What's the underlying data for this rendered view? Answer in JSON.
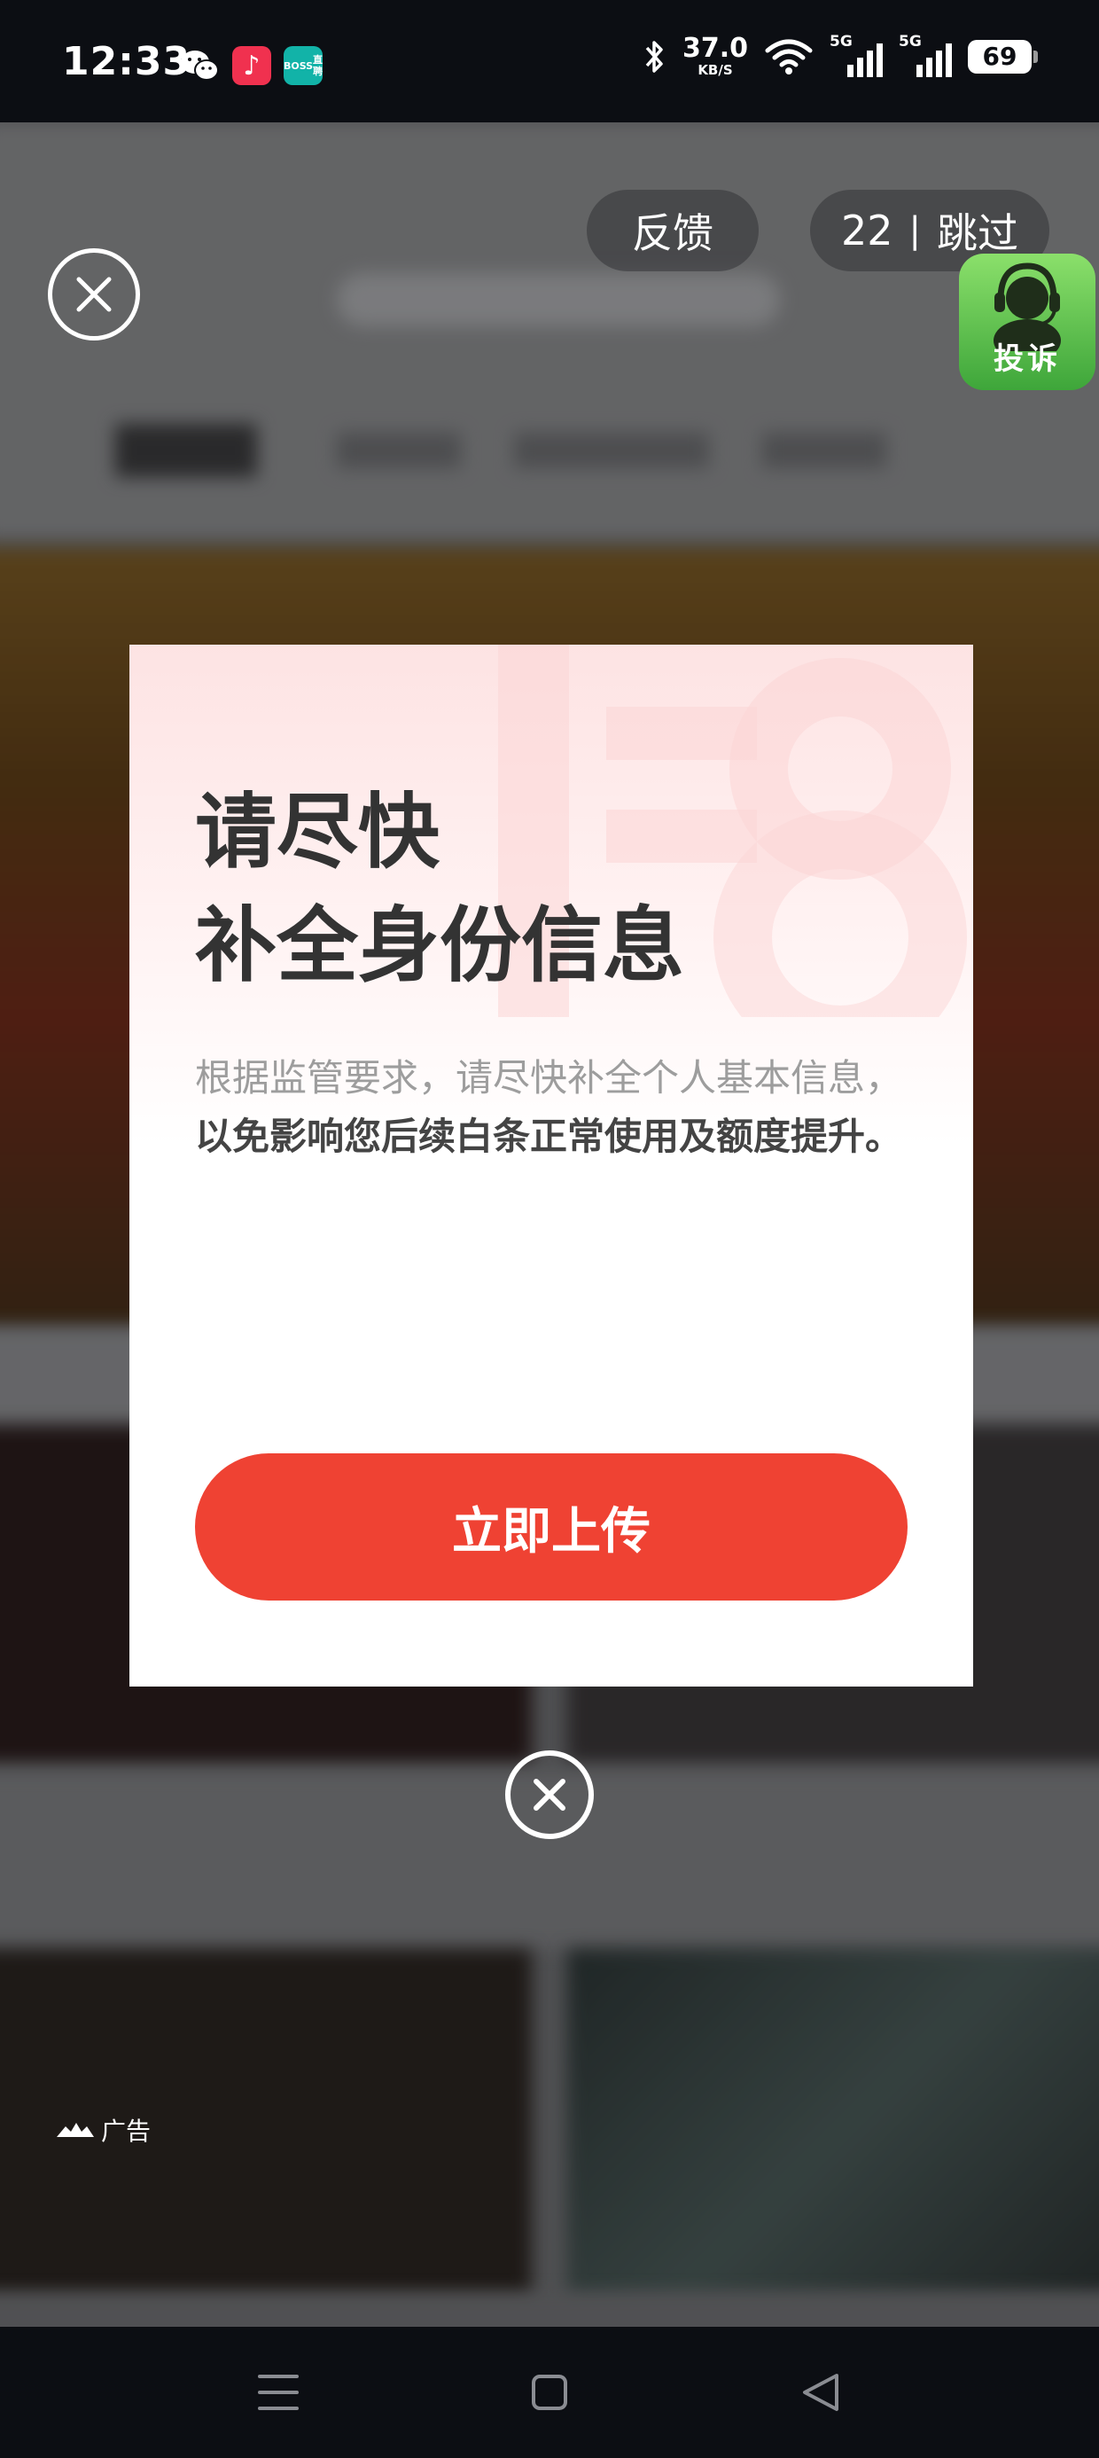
{
  "status_bar": {
    "time": "12:33",
    "net_speed_value": "37.0",
    "net_speed_unit": "KB/S",
    "sim1_tag": "5G",
    "sim2_tag": "5G",
    "battery": "69",
    "boss_line1": "BOSS",
    "boss_line2": "直聘",
    "icons": [
      "wechat-icon",
      "music-app-icon",
      "boss-zhipin-icon",
      "bluetooth-icon",
      "wifi-icon",
      "signal-icon",
      "battery-icon"
    ]
  },
  "ad_overlay": {
    "feedback_label": "反馈",
    "countdown": "22",
    "separator": "|",
    "skip_label": "跳过",
    "complain_label": "投诉",
    "ad_label": "广告"
  },
  "dialog": {
    "title_line1": "请尽快",
    "title_line2": "补全身份信息",
    "body_normal": "根据监管要求，请尽快补全个人基本信息，",
    "body_bold": "以免影响您后续白条正常使用及额度提升。",
    "button_label": "立即上传",
    "accent_color": "#ef4233"
  },
  "nav_bar": {
    "icons": [
      "menu-icon",
      "home-icon",
      "back-icon"
    ]
  }
}
